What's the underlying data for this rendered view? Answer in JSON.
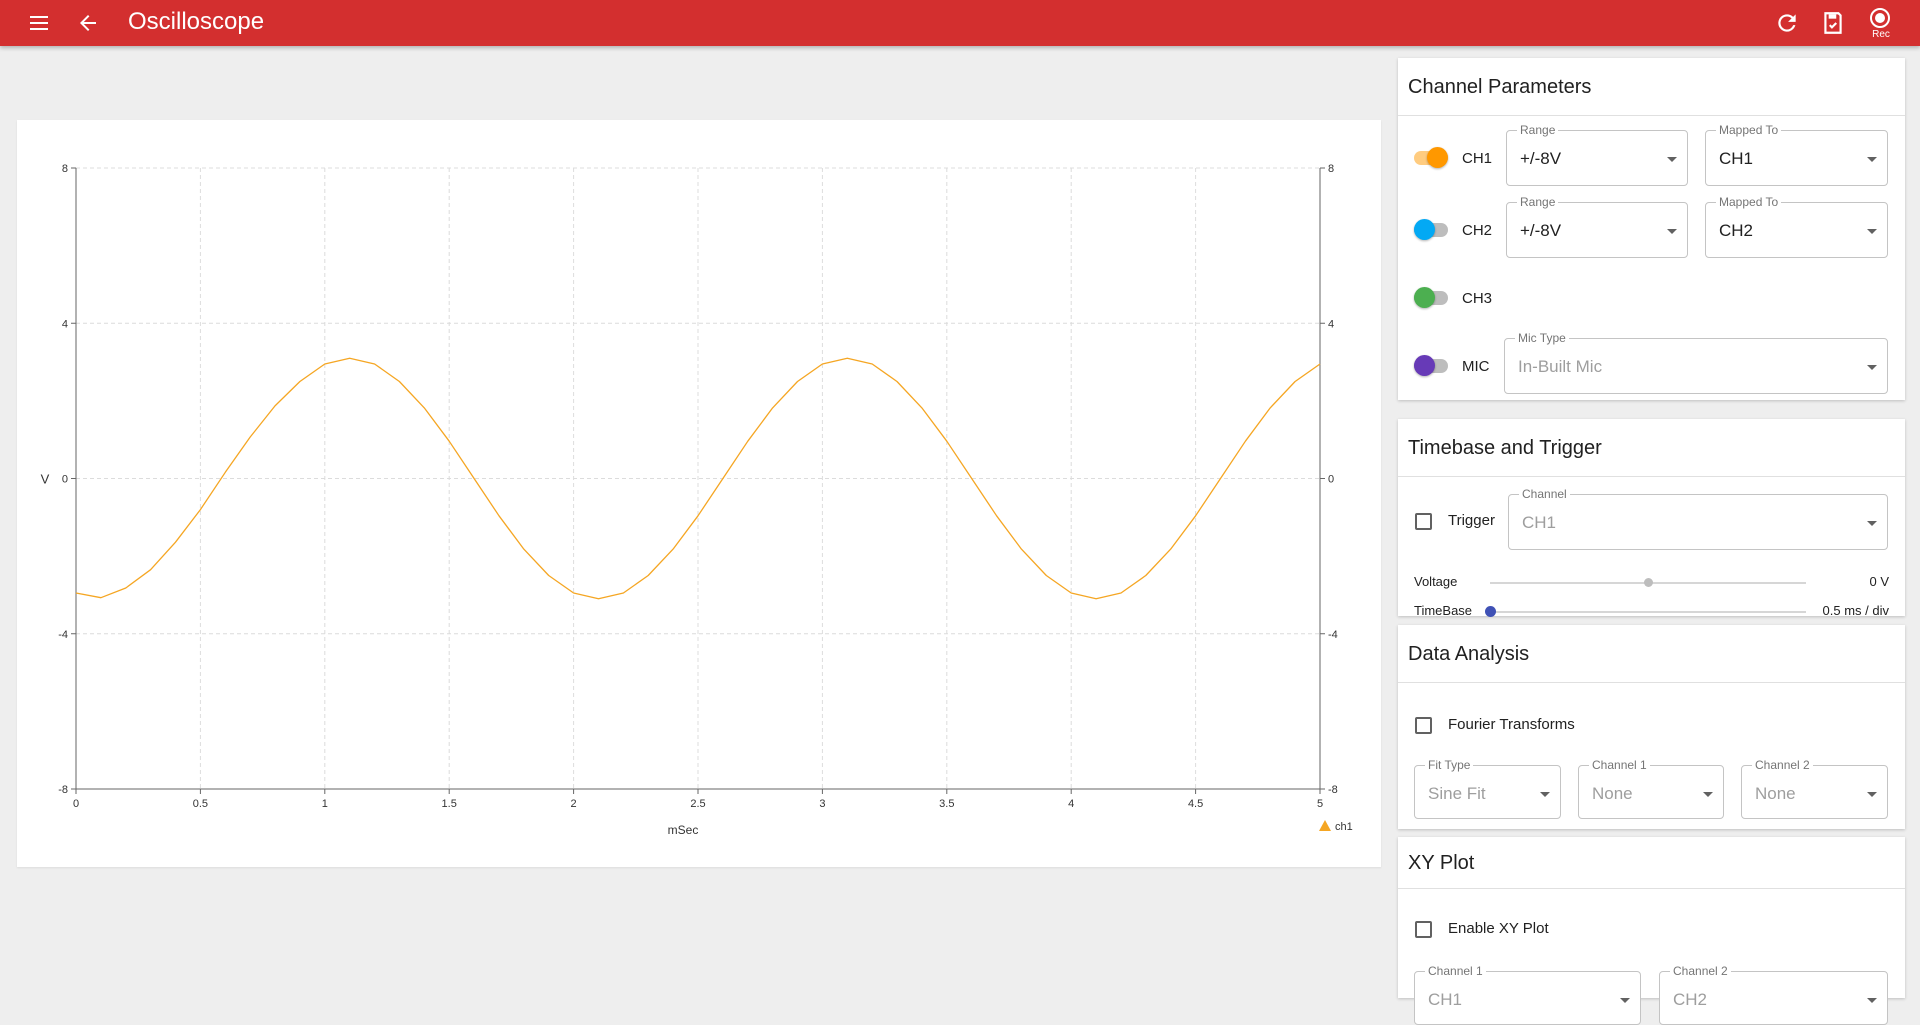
{
  "appbar": {
    "title": "Oscilloscope",
    "menu_icon": "menu-icon",
    "back_icon": "arrow-back-icon",
    "actions": [
      {
        "name": "refresh-icon"
      },
      {
        "name": "save-icon"
      },
      {
        "name": "record-icon",
        "label": "Rec"
      }
    ],
    "color": "#d32f2f"
  },
  "chart_data": {
    "type": "line",
    "title": "",
    "xlabel": "mSec",
    "ylabel": "V",
    "xlim": [
      0,
      5
    ],
    "ylim": [
      -8,
      8
    ],
    "xticks": [
      "0",
      "0.5",
      "1",
      "1.5",
      "2",
      "2.5",
      "3",
      "3.5",
      "4",
      "4.5",
      "5"
    ],
    "yticks": [
      "8",
      "4",
      "0",
      "-4",
      "-8"
    ],
    "right_yticks": [
      "8",
      "4",
      "0",
      "-4",
      "-8"
    ],
    "grid": true,
    "legend": "bottom-right",
    "series": [
      {
        "name": "ch1",
        "color": "#f5a623",
        "amplitude": 3.1,
        "period_ms": 2.0,
        "phase_peak_ms": 1.1,
        "x": [
          0,
          0.1,
          0.2,
          0.3,
          0.4,
          0.5,
          0.6,
          0.7,
          0.8,
          0.9,
          1.0,
          1.1,
          1.2,
          1.3,
          1.4,
          1.5,
          1.6,
          1.7,
          1.8,
          1.9,
          2.0,
          2.1,
          2.2,
          2.3,
          2.4,
          2.5,
          2.6,
          2.7,
          2.8,
          2.9,
          3.0,
          3.1,
          3.2,
          3.3,
          3.4,
          3.5,
          3.6,
          3.7,
          3.8,
          3.9,
          4.0,
          4.1,
          4.2,
          4.3,
          4.4,
          4.5,
          4.6,
          4.7,
          4.8,
          4.9,
          5.0
        ],
        "y": [
          -2.95,
          -3.07,
          -2.82,
          -2.35,
          -1.64,
          -0.8,
          0.16,
          1.07,
          1.87,
          2.5,
          2.95,
          3.1,
          2.95,
          2.5,
          1.82,
          0.96,
          0.0,
          -0.96,
          -1.82,
          -2.5,
          -2.95,
          -3.1,
          -2.95,
          -2.5,
          -1.82,
          -0.96,
          0.0,
          0.96,
          1.82,
          2.5,
          2.95,
          3.1,
          2.95,
          2.5,
          1.82,
          0.96,
          0.0,
          -0.96,
          -1.82,
          -2.5,
          -2.95,
          -3.1,
          -2.95,
          -2.5,
          -1.82,
          -0.96,
          0.0,
          0.96,
          1.82,
          2.5,
          2.95
        ]
      }
    ]
  },
  "channel_params": {
    "title": "Channel Parameters",
    "rows": [
      {
        "label": "CH1",
        "on": true,
        "color": "#ff9800",
        "range_legend": "Range",
        "range": "+/-8V",
        "mapped_legend": "Mapped To",
        "mapped": "CH1"
      },
      {
        "label": "CH2",
        "on": false,
        "color": "#03a9f4",
        "range_legend": "Range",
        "range": "+/-8V",
        "mapped_legend": "Mapped To",
        "mapped": "CH2"
      },
      {
        "label": "CH3",
        "on": false,
        "color": "#4caf50"
      },
      {
        "label": "MIC",
        "on": false,
        "color": "#673ab7",
        "mic_legend": "Mic Type",
        "mic": "In-Built Mic"
      }
    ]
  },
  "timebase": {
    "title": "Timebase and Trigger",
    "trigger_label": "Trigger",
    "channel_legend": "Channel",
    "channel": "CH1",
    "voltage_label": "Voltage",
    "voltage_value": "0 V",
    "voltage_fraction": 0.5,
    "timebase_label": "TimeBase",
    "timebase_value": "0.5 ms / div",
    "timebase_fraction": 0.0
  },
  "analysis": {
    "title": "Data Analysis",
    "fourier_label": "Fourier Transforms",
    "fit_legend": "Fit Type",
    "fit": "Sine Fit",
    "ch1_legend": "Channel 1",
    "ch1": "None",
    "ch2_legend": "Channel 2",
    "ch2": "None"
  },
  "xyplot": {
    "title": "XY Plot",
    "enable_label": "Enable XY Plot",
    "ch1_legend": "Channel 1",
    "ch1": "CH1",
    "ch2_legend": "Channel 2",
    "ch2": "CH2"
  }
}
